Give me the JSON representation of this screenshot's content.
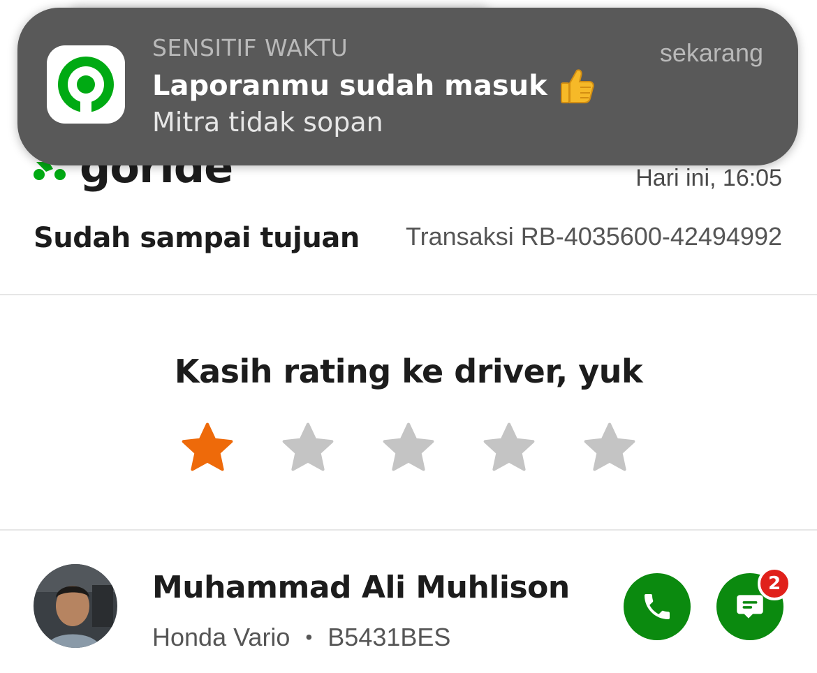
{
  "notification": {
    "label": "SENSITIF WAKTU",
    "time": "sekarang",
    "title": "Laporanmu sudah masuk",
    "body": "Mitra tidak sopan",
    "app_icon": "gojek-icon",
    "emoji": "thumbs-up-icon"
  },
  "order": {
    "service": "goride",
    "service_icon": "scooter-icon",
    "time": "Hari ini, 16:05",
    "status": "Sudah sampai tujuan",
    "transaction": "Transaksi RB-4035600-42494992"
  },
  "rating": {
    "title": "Kasih rating ke driver, yuk",
    "max": 5,
    "value": 1,
    "active_color": "#EE6A0A",
    "inactive_color": "#C4C4C4"
  },
  "driver": {
    "name": "Muhammad Ali Muhlison",
    "vehicle": "Honda Vario",
    "separator": "•",
    "plate": "B5431BES",
    "call_icon": "phone-icon",
    "chat_icon": "chat-icon",
    "chat_badge_count": "2"
  },
  "colors": {
    "brand_green": "#0B8A0F",
    "gojek_green": "#00AA13",
    "notification_bg": "#595959",
    "badge_red": "#E0211B"
  }
}
